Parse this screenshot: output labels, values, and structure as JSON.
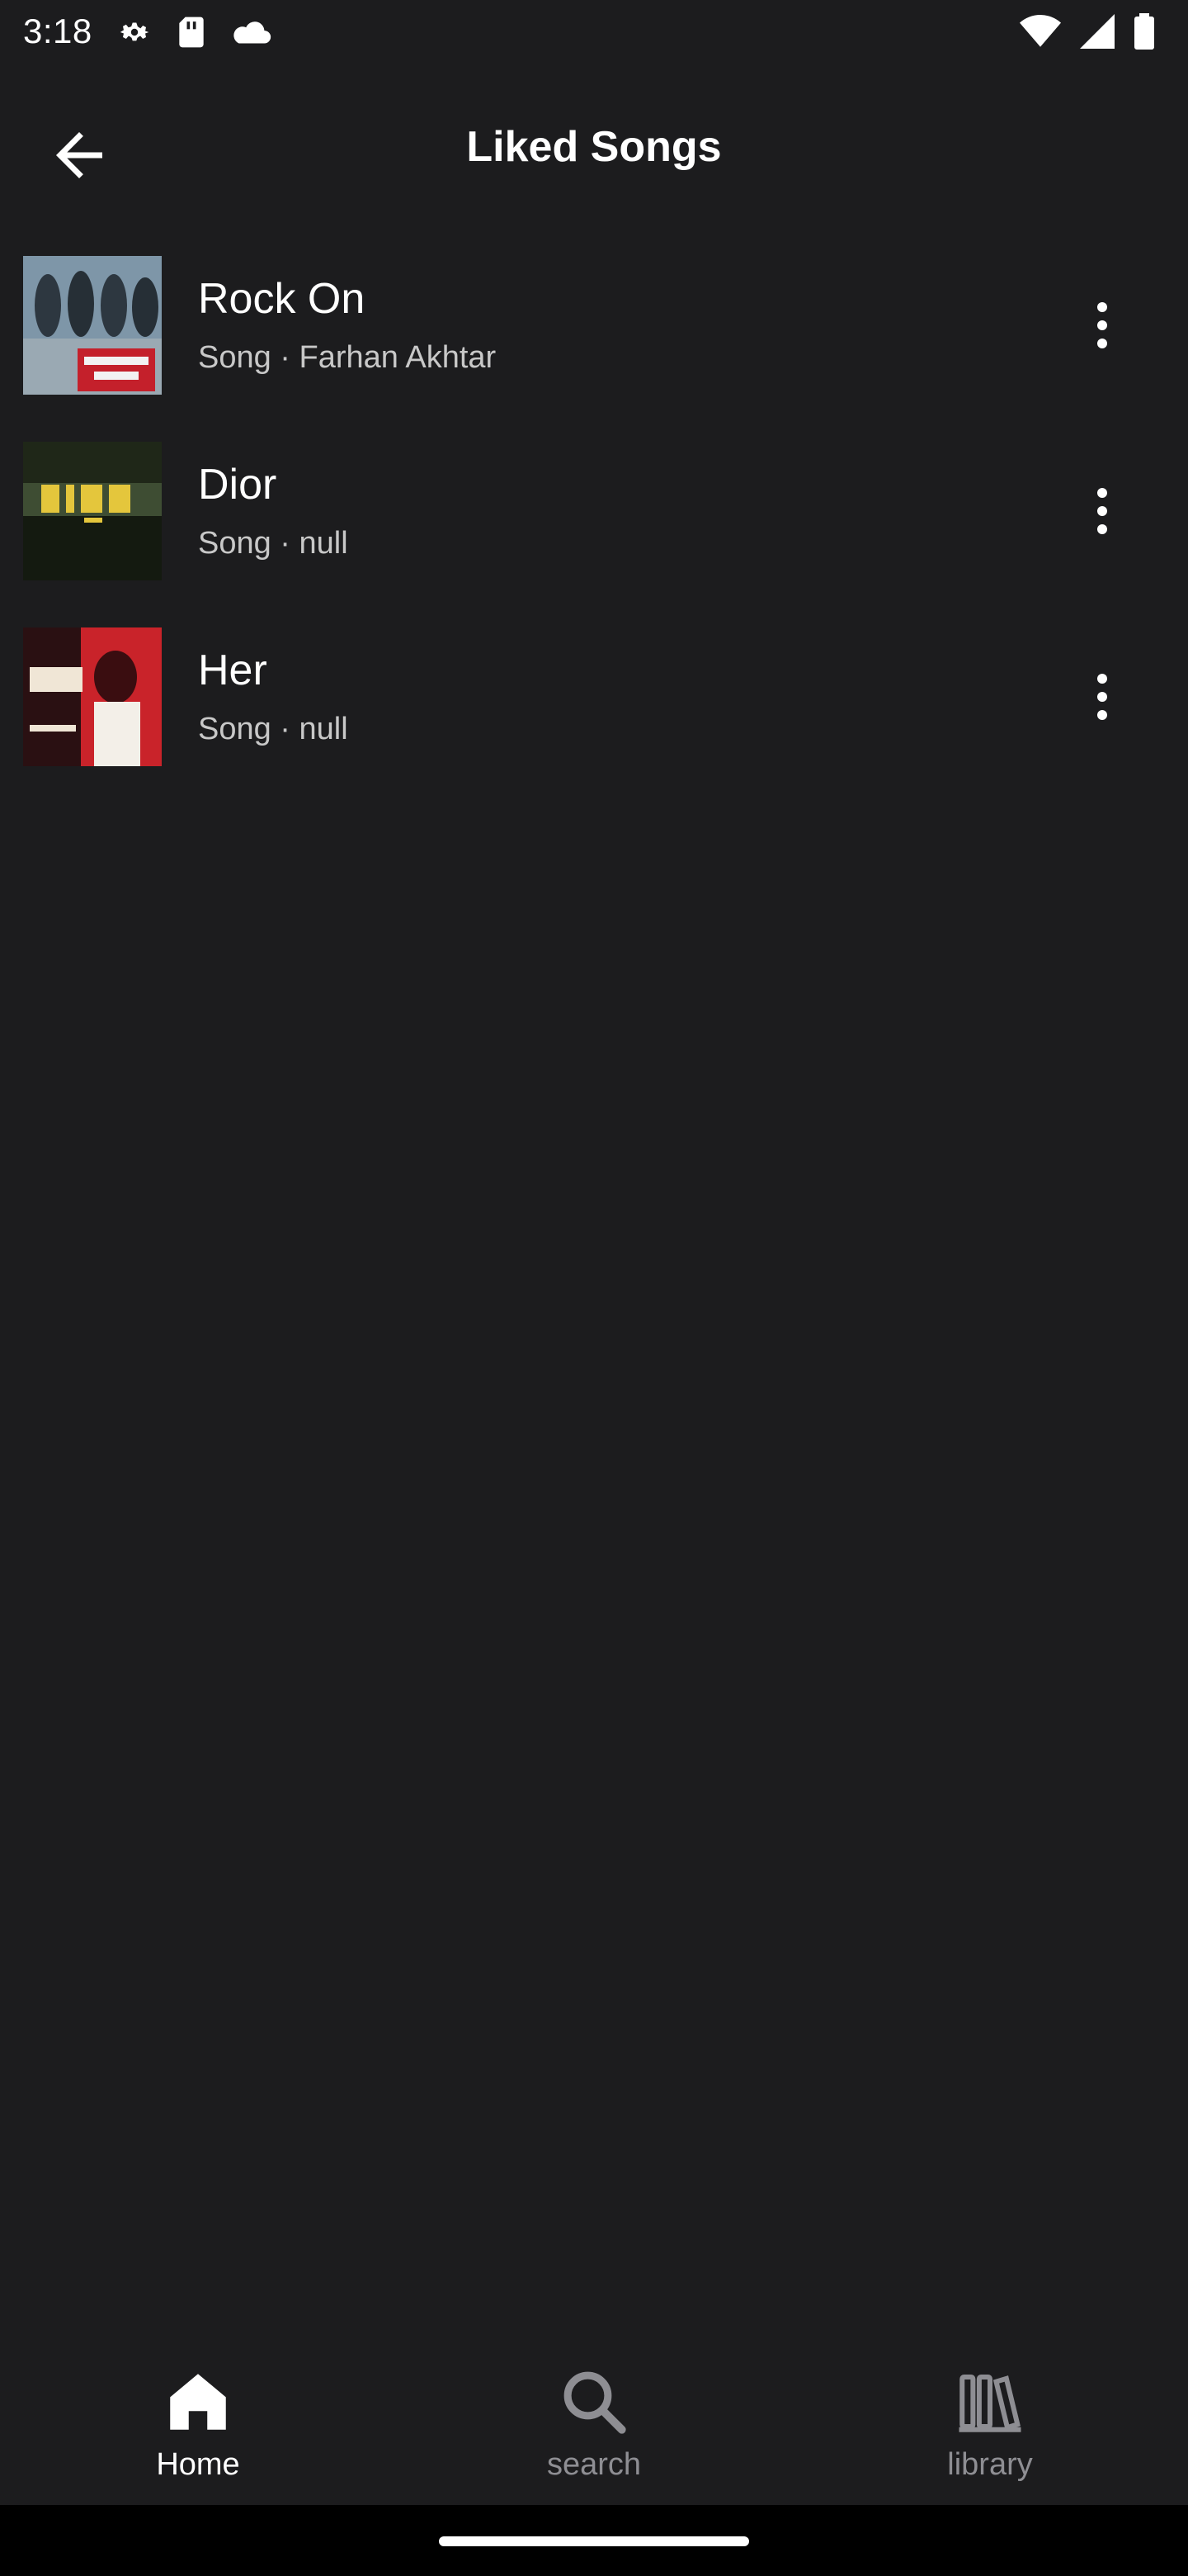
{
  "status_bar": {
    "time": "3:18",
    "left_icons": [
      "settings-icon",
      "sd-card-icon",
      "cloud-icon"
    ],
    "right_icons": [
      "wifi-icon",
      "signal-icon",
      "battery-icon"
    ]
  },
  "app_bar": {
    "title": "Liked Songs",
    "back_icon": "arrow-left-icon"
  },
  "songs": [
    {
      "title": "Rock On",
      "subtitle": "Song · Farhan Akhtar",
      "thumb_colors": [
        "#6f8aa0",
        "#3d4a55",
        "#c4202b"
      ]
    },
    {
      "title": "Dior",
      "subtitle": "Song · null",
      "thumb_colors": [
        "#26301f",
        "#e4c63c",
        "#5b6a3b"
      ]
    },
    {
      "title": "Her",
      "subtitle": "Song · null",
      "thumb_colors": [
        "#c9232a",
        "#2a1012",
        "#f0e6d6"
      ]
    }
  ],
  "bottom_nav": {
    "items": [
      {
        "label": "Home",
        "icon": "home-icon",
        "active": true
      },
      {
        "label": "search",
        "icon": "search-icon",
        "active": false
      },
      {
        "label": "library",
        "icon": "library-icon",
        "active": false
      }
    ]
  },
  "colors": {
    "background": "#1c1c1e",
    "text_primary": "#ffffff",
    "text_secondary": "#c8c8c8",
    "nav_inactive": "#8e8e93"
  }
}
